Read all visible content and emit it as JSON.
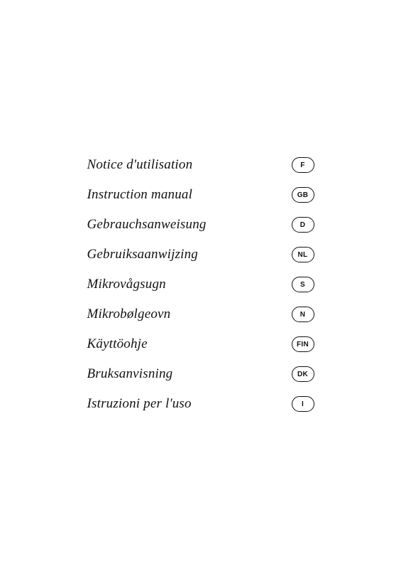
{
  "items": [
    {
      "label": "Notice d'utilisation",
      "badge": "F"
    },
    {
      "label": "Instruction manual",
      "badge": "GB"
    },
    {
      "label": "Gebrauchsanweisung",
      "badge": "D"
    },
    {
      "label": "Gebruiksaanwijzing",
      "badge": "NL"
    },
    {
      "label": "Mikrovågsugn",
      "badge": "S"
    },
    {
      "label": "Mikrobølgeovn",
      "badge": "N"
    },
    {
      "label": "Käyttöohje",
      "badge": "FIN"
    },
    {
      "label": "Bruksanvisning",
      "badge": "DK"
    },
    {
      "label": "Istruzioni per l'uso",
      "badge": "I"
    }
  ]
}
